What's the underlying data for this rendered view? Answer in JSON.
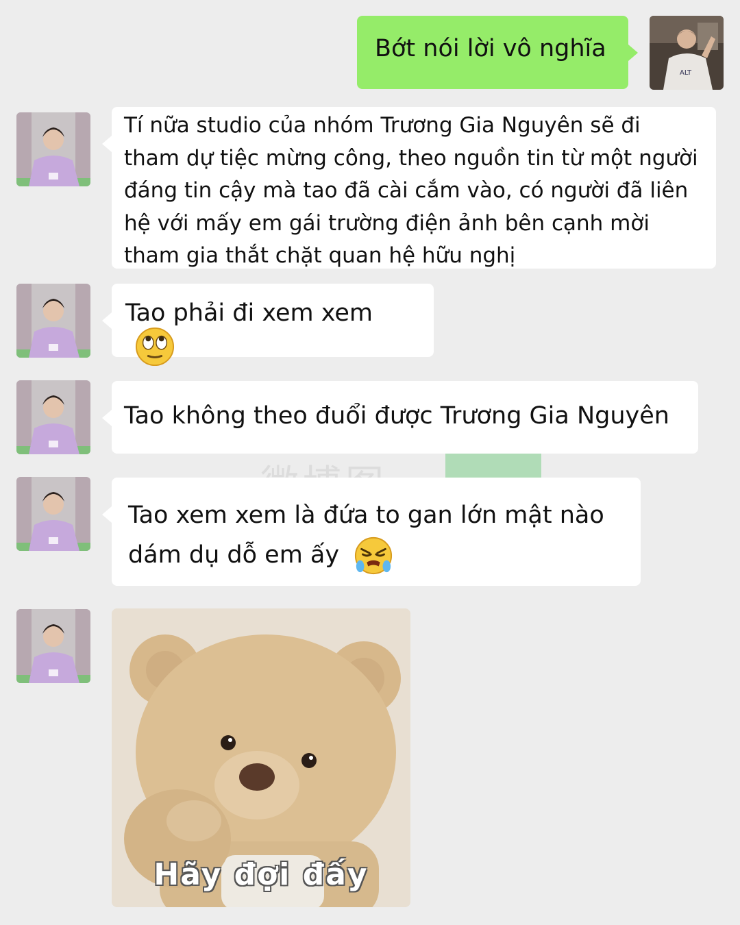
{
  "messages": [
    {
      "side": "right",
      "text": "Bớt nói lời vô nghĩa"
    },
    {
      "side": "left",
      "text": "Tí nữa studio của nhóm Trương Gia Nguyên sẽ đi tham dự tiệc mừng công, theo nguồn tin từ một người đáng tin cậy mà tao đã cài cắm vào, có người đã liên hệ với mấy em gái trường điện ảnh bên cạnh mời tham gia thắt chặt quan hệ hữu nghị"
    },
    {
      "side": "left",
      "text": "Tao phải đi xem xem",
      "emoji": "rolling-eyes-emoji"
    },
    {
      "side": "left",
      "text": "Tao không theo đuổi được Trương Gia Nguyên"
    },
    {
      "side": "left",
      "text": "Tao xem xem là đứa to gan lớn mật nào dám dụ dỗ em ấy",
      "emoji": "angry-crying-emoji"
    },
    {
      "side": "left",
      "type": "sticker",
      "sticker": "teddy-bear-sticker",
      "caption": "Hãy đợi đấy"
    }
  ],
  "watermark": {
    "text": "微博图"
  },
  "colors": {
    "background": "#ededed",
    "outgoing_bubble": "#95ec69",
    "incoming_bubble": "#ffffff"
  }
}
